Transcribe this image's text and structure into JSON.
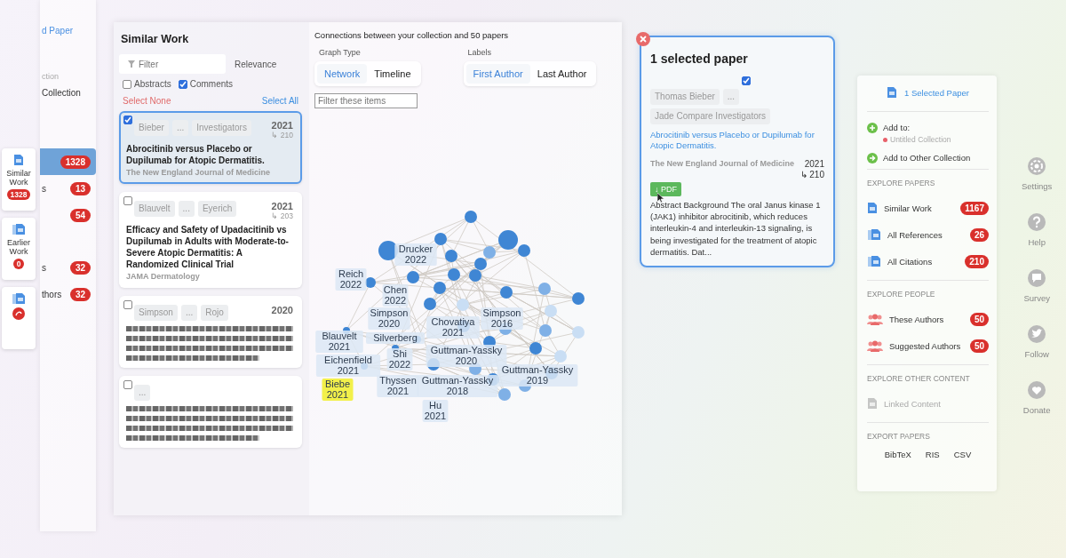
{
  "back_sidebar": {
    "items": [
      {
        "kind": "link",
        "text": "d Paper",
        "selected": false
      },
      {
        "kind": "sub",
        "text": "ction",
        "selected": false
      },
      {
        "kind": "item",
        "text": "Collection",
        "selected": false
      },
      {
        "kind": "count",
        "badge": "1328",
        "selected": true
      },
      {
        "kind": "count",
        "text": "s",
        "badge": "13",
        "selected": false
      },
      {
        "kind": "count",
        "badge": "54",
        "selected": false
      },
      {
        "kind": "count",
        "text": "s",
        "badge": "32",
        "selected": false
      },
      {
        "kind": "count",
        "text": "thors",
        "badge": "32",
        "selected": false
      }
    ]
  },
  "side_tabs": [
    {
      "kind": "count",
      "label": "Similar Work",
      "badge": "1328"
    },
    {
      "kind": "count",
      "label": "Earlier Work",
      "badge": "0"
    },
    {
      "kind": "alert"
    }
  ],
  "similar_work": {
    "title": "Similar Work",
    "filter": {
      "placeholder": "Filter"
    },
    "sort": "Relevance",
    "options": [
      {
        "label": "Abstracts",
        "checked": false
      },
      {
        "label": "Comments",
        "checked": true
      }
    ],
    "select_none": "Select None",
    "select_all": "Select All",
    "papers": [
      {
        "checked": true,
        "selected": true,
        "authors": [
          "Bieber",
          "...",
          "Investigators"
        ],
        "year": "2021",
        "citations": "↳ 210",
        "title": "Abrocitinib versus Placebo or Dupilumab for Atopic Dermatitis.",
        "journal": "The New England Journal of Medicine"
      },
      {
        "checked": false,
        "selected": false,
        "authors": [
          "Blauvelt",
          "...",
          "Eyerich"
        ],
        "year": "2021",
        "citations": "↳ 203",
        "title": "Efficacy and Safety of Upadacitinib vs Dupilumab in Adults with Moderate-to-Severe Atopic Dermatitis: A Randomized Clinical Trial",
        "journal": "JAMA Dermatology"
      },
      {
        "checked": false,
        "selected": false,
        "authors": [
          "Simpson",
          "...",
          "Rojo"
        ],
        "year": "2020",
        "blurred": true
      },
      {
        "checked": false,
        "selected": false,
        "authors": [
          "..."
        ],
        "blurred": true
      }
    ]
  },
  "graph": {
    "caption": "Connections between your collection and 50 papers",
    "graph_type": {
      "label": "Graph Type",
      "options": [
        {
          "label": "Network",
          "selected": true
        },
        {
          "label": "Timeline",
          "selected": false
        }
      ]
    },
    "labels": {
      "label": "Labels",
      "options": [
        {
          "label": "First Author",
          "selected": true
        },
        {
          "label": "Last Author",
          "selected": false
        }
      ]
    },
    "filter": {
      "placeholder": "Filter these items"
    },
    "nodes": [
      {
        "name": "Drucker",
        "year": "2022",
        "selected": false
      },
      {
        "name": "Reich",
        "year": "2022",
        "selected": false
      },
      {
        "name": "Chen",
        "year": "2022",
        "selected": false
      },
      {
        "name": "Simpson",
        "year": "2020",
        "selected": false
      },
      {
        "name": "Blauvelt",
        "year": "2021",
        "selected": false
      },
      {
        "name": "Silverberg",
        "selected": false
      },
      {
        "name": "Chovatiya",
        "year": "2021",
        "selected": false
      },
      {
        "name": "Simpson",
        "year": "2016",
        "selected": false
      },
      {
        "name": "Eichenfield",
        "year": "2021",
        "selected": false
      },
      {
        "name": "Shi",
        "year": "2022",
        "selected": false
      },
      {
        "name": "Guttman-Yassky",
        "year": "2020",
        "selected": false
      },
      {
        "name": "Biebe",
        "year": "2021",
        "selected": true
      },
      {
        "name": "Thyssen",
        "year": "2021",
        "selected": false
      },
      {
        "name": "Guttman-Yassky",
        "year": "2018",
        "selected": false
      },
      {
        "name": "Guttman-Yassky",
        "year": "2019",
        "selected": false
      },
      {
        "name": "Hu",
        "year": "2021",
        "selected": false
      }
    ]
  },
  "selected_paper": {
    "title": "1 selected paper",
    "checked": true,
    "authors": [
      "Thomas Bieber",
      "...",
      "Jade Compare Investigators"
    ],
    "paper_title": "Abrocitinib versus Placebo or Dupilumab for Atopic Dermatitis.",
    "journal": "The New England Journal of Medicine",
    "year": "2021",
    "citations": "↳ 210",
    "pdf": "↓ PDF",
    "abstract": "Abstract Background The oral Janus kinase 1 (JAK1) inhibitor abrocitinib, which reduces interleukin-4 and interleukin-13 signaling, is being investigated for the treatment of atopic dermatitis. Dat..."
  },
  "actions": {
    "header": "1 Selected Paper",
    "add_to": "Add to:",
    "collection": {
      "name": "Untitled Collection",
      "color": "#e8606a"
    },
    "add_other": "Add to Other Collection",
    "sections": [
      {
        "title": "EXPLORE PAPERS",
        "kind": "papers",
        "items": [
          {
            "label": "Similar Work",
            "badge": "1167",
            "disabled": false
          },
          {
            "label": "All References",
            "badge": "26",
            "disabled": false
          },
          {
            "label": "All Citations",
            "badge": "210",
            "disabled": false
          }
        ]
      },
      {
        "title": "EXPLORE PEOPLE",
        "kind": "people",
        "items": [
          {
            "label": "These Authors",
            "badge": "50",
            "disabled": false
          },
          {
            "label": "Suggested Authors",
            "badge": "50",
            "disabled": false
          }
        ]
      },
      {
        "title": "EXPLORE OTHER CONTENT",
        "kind": "content",
        "items": [
          {
            "label": "Linked Content",
            "disabled": true
          }
        ]
      }
    ],
    "export": {
      "title": "EXPORT PAPERS",
      "formats": [
        "BibTeX",
        "RIS",
        "CSV"
      ]
    }
  },
  "tools": [
    {
      "kind": "settings",
      "label": "Settings"
    },
    {
      "kind": "help",
      "label": "Help"
    },
    {
      "kind": "survey",
      "label": "Survey"
    },
    {
      "kind": "follow",
      "label": "Follow"
    },
    {
      "kind": "donate",
      "label": "Donate"
    }
  ]
}
